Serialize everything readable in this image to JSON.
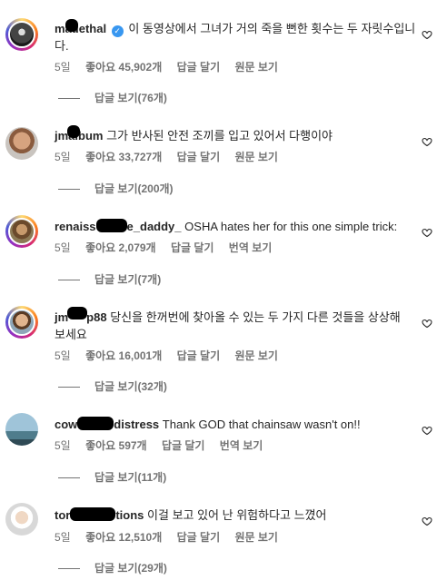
{
  "comments": [
    {
      "username": "madethal",
      "verified": true,
      "text": "이 동영상에서 그녀가 거의 죽을 뻔한 횟수는 두 자릿수입니다.",
      "time": "5일",
      "likes": "좋아요 45,902개",
      "reply_label": "답글 달기",
      "action_label": "원문 보기",
      "view_replies": "답글 보기(76개)"
    },
    {
      "username": "jm album",
      "verified": false,
      "text": "그가 반사된 안전 조끼를 입고 있어서 다행이야",
      "time": "5일",
      "likes": "좋아요 33,727개",
      "reply_label": "답글 달기",
      "action_label": "원문 보기",
      "view_replies": "답글 보기(200개)"
    },
    {
      "username": "renaiss e_daddy_",
      "verified": false,
      "text": "OSHA hates her for this one simple trick:",
      "time": "5일",
      "likes": "좋아요 2,079개",
      "reply_label": "답글 달기",
      "action_label": "번역 보기",
      "view_replies": "답글 보기(7개)"
    },
    {
      "username": "jm p88",
      "verified": false,
      "text": "당신을 한꺼번에 찾아올 수 있는 두 가지 다른 것들을 상상해 보세요",
      "time": "5일",
      "likes": "좋아요 16,001개",
      "reply_label": "답글 달기",
      "action_label": "원문 보기",
      "view_replies": "답글 보기(32개)"
    },
    {
      "username": "cow distress",
      "verified": false,
      "text": "Thank GOD that chainsaw wasn't on!!",
      "time": "5일",
      "likes": "좋아요 597개",
      "reply_label": "답글 달기",
      "action_label": "번역 보기",
      "view_replies": "답글 보기(11개)"
    },
    {
      "username": "tor tions",
      "verified": false,
      "text": "이걸 보고 있어 난 위험하다고 느꼈어",
      "time": "5일",
      "likes": "좋아요 12,510개",
      "reply_label": "답글 달기",
      "action_label": "원문 보기",
      "view_replies": "답글 보기(29개)"
    }
  ],
  "icons": {
    "verified": "verified-badge-icon",
    "like": "heart-icon"
  },
  "colors": {
    "text": "#262626",
    "muted": "#737373",
    "verified": "#3897f0",
    "redaction": "#000000"
  }
}
